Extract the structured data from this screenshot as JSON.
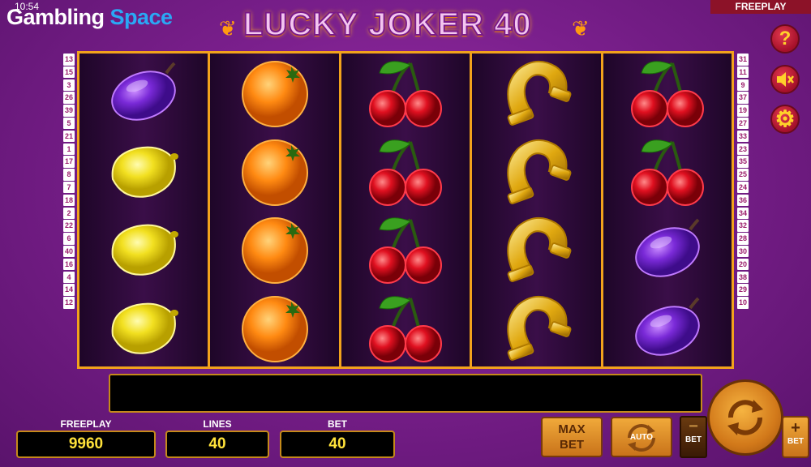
{
  "status_bar": {
    "time": "10:54"
  },
  "brand": {
    "part1": "Gambling ",
    "part2": "Space"
  },
  "mode_badge": "FREEPLAY",
  "game_title": "LUCKY JOKER 40",
  "line_numbers_left": [
    "13",
    "15",
    "3",
    "26",
    "39",
    "5",
    "21",
    "1",
    "17",
    "8",
    "7",
    "18",
    "2",
    "22",
    "6",
    "40",
    "16",
    "4",
    "14",
    "12"
  ],
  "line_numbers_right": [
    "31",
    "11",
    "9",
    "37",
    "19",
    "27",
    "33",
    "23",
    "35",
    "25",
    "24",
    "36",
    "34",
    "32",
    "28",
    "30",
    "20",
    "38",
    "29",
    "10"
  ],
  "reels": [
    [
      "plum",
      "lemon",
      "lemon",
      "lemon"
    ],
    [
      "orange",
      "orange",
      "orange",
      "orange"
    ],
    [
      "cherry",
      "cherry",
      "cherry",
      "cherry"
    ],
    [
      "horseshoe",
      "horseshoe",
      "horseshoe",
      "horseshoe"
    ],
    [
      "cherry",
      "cherry",
      "plum",
      "plum"
    ]
  ],
  "side_buttons": {
    "help": "?"
  },
  "message": "",
  "panels": {
    "freeplay_label": "FREEPLAY",
    "freeplay_value": "9960",
    "lines_label": "LINES",
    "lines_value": "40",
    "bet_label": "BET",
    "bet_value": "40"
  },
  "buttons": {
    "max_bet_1": "MAX",
    "max_bet_2": "BET",
    "auto": "AUTO",
    "bet_minus": "−",
    "bet_minus_label": "BET",
    "bet_plus": "+",
    "bet_plus_label": "BET"
  },
  "colors": {
    "frame": "#f2a21c",
    "background": "#7a1f8c",
    "value_text": "#ffe23a"
  }
}
